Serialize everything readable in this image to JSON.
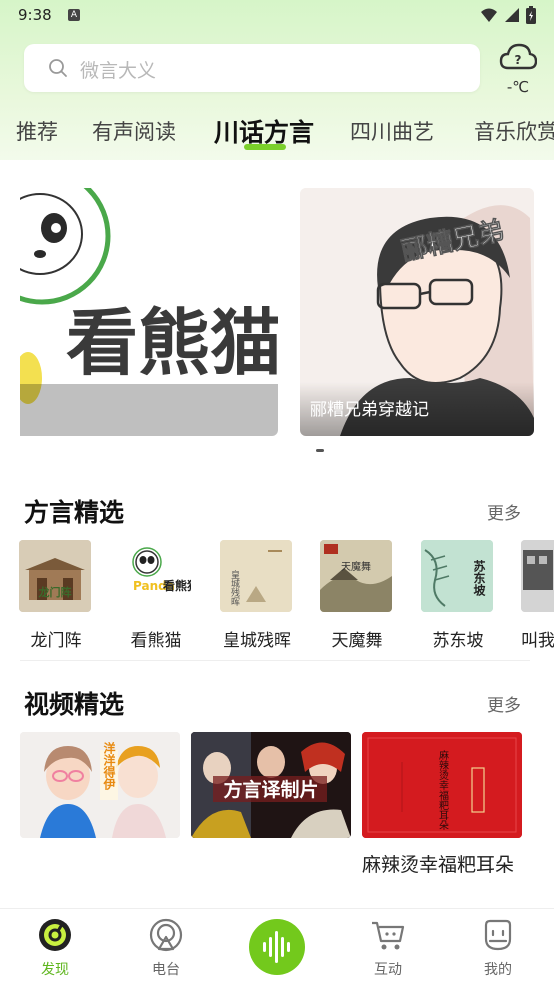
{
  "status": {
    "time": "9:38",
    "notif": "A"
  },
  "search": {
    "placeholder": "微言大义"
  },
  "weather": {
    "temp": "-℃",
    "icon": "cloud-question-icon"
  },
  "tabs": [
    {
      "label": "推荐"
    },
    {
      "label": "有声阅读"
    },
    {
      "label": "川话方言",
      "active": true
    },
    {
      "label": "四川曲艺"
    },
    {
      "label": "音乐欣赏"
    }
  ],
  "carousel": {
    "slides": [
      {
        "art_text": "看熊猫",
        "caption": ""
      },
      {
        "art_text": "郦糟兄弟",
        "caption": "郦糟兄弟穿越记"
      }
    ]
  },
  "dialect_section": {
    "title": "方言精选",
    "more": "更多",
    "items": [
      {
        "label": "龙门阵",
        "cover_text": "龙门阵"
      },
      {
        "label": "看熊猫",
        "cover_text": "看熊猫"
      },
      {
        "label": "皇城残晖",
        "cover_text": "皇城残晖"
      },
      {
        "label": "天魔舞",
        "cover_text": "天魔舞"
      },
      {
        "label": "苏东坡",
        "cover_text": "苏东坡"
      },
      {
        "label": "叫我",
        "cover_text": ""
      }
    ]
  },
  "video_section": {
    "title": "视频精选",
    "more": "更多",
    "items": [
      {
        "title": "",
        "thumb_text": "洋洋得伊"
      },
      {
        "title": "",
        "thumb_text": "方言译制片"
      },
      {
        "title": "麻辣烫幸福粑耳朵",
        "thumb_text": "麻辣烫幸福粑耳朵"
      }
    ]
  },
  "nav": [
    {
      "label": "发现",
      "active": true,
      "icon": "discover-icon"
    },
    {
      "label": "电台",
      "icon": "radio-icon"
    },
    {
      "label": "",
      "icon": "voice-wave-icon"
    },
    {
      "label": "互动",
      "icon": "cart-icon"
    },
    {
      "label": "我的",
      "icon": "profile-icon"
    }
  ],
  "colors": {
    "accent": "#73c91c",
    "active_tab_underline": "#7bd02b",
    "nav_active": "#5fb61f"
  }
}
